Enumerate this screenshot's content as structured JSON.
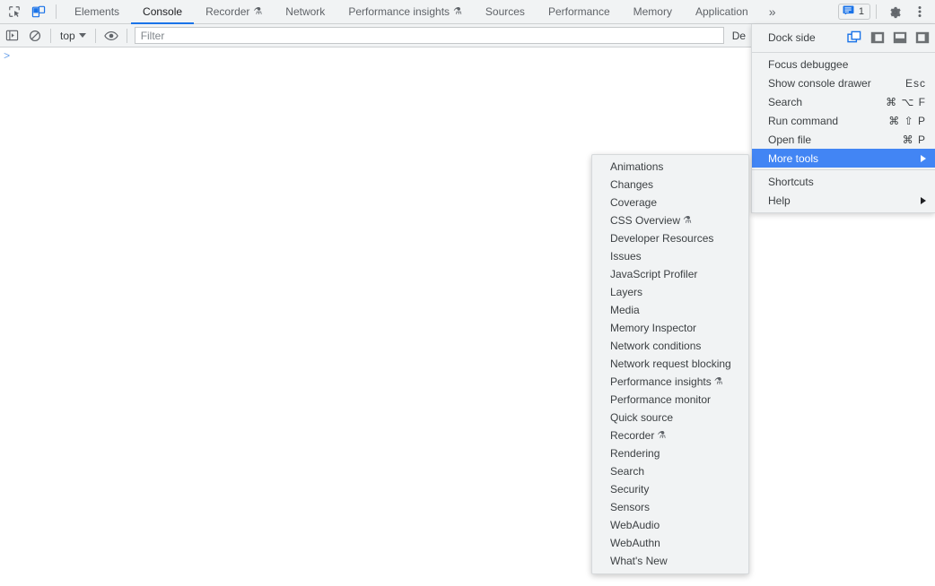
{
  "tabbar": {
    "inspect_icon": "inspect-element-icon",
    "device_icon": "device-toolbar-icon",
    "tabs": [
      {
        "label": "Elements",
        "experimental": false,
        "active": false
      },
      {
        "label": "Console",
        "experimental": false,
        "active": true
      },
      {
        "label": "Recorder",
        "experimental": true,
        "active": false
      },
      {
        "label": "Network",
        "experimental": false,
        "active": false
      },
      {
        "label": "Performance insights",
        "experimental": true,
        "active": false
      },
      {
        "label": "Sources",
        "experimental": false,
        "active": false
      },
      {
        "label": "Performance",
        "experimental": false,
        "active": false
      },
      {
        "label": "Memory",
        "experimental": false,
        "active": false
      },
      {
        "label": "Application",
        "experimental": false,
        "active": false
      }
    ],
    "overflow_label": "»",
    "issues_count": "1",
    "issues_icon": "issues-message-icon",
    "settings_icon": "gear-icon",
    "menu_icon": "three-dot-menu-icon",
    "flask_glyph": "⚗"
  },
  "console_toolbar": {
    "sidebar_icon": "console-sidebar-toggle-icon",
    "clear_icon": "clear-console-icon",
    "context": "top",
    "eye_icon": "live-expression-eye-icon",
    "filter_placeholder": "Filter",
    "levels": "De"
  },
  "console_body": {
    "prompt": ">"
  },
  "main_menu": {
    "dock_side": {
      "label": "Dock side",
      "options": [
        {
          "name": "undock-into-separate-window",
          "active": true
        },
        {
          "name": "dock-to-left",
          "active": false
        },
        {
          "name": "dock-to-bottom",
          "active": false
        },
        {
          "name": "dock-to-right",
          "active": false
        }
      ]
    },
    "items": [
      {
        "label": "Focus debuggee",
        "shortcut": "",
        "arrow": false,
        "selected": false
      },
      {
        "label": "Show console drawer",
        "shortcut": "Esc",
        "arrow": false,
        "selected": false
      },
      {
        "label": "Search",
        "shortcut": "⌘ ⌥ F",
        "arrow": false,
        "selected": false
      },
      {
        "label": "Run command",
        "shortcut": "⌘ ⇧ P",
        "arrow": false,
        "selected": false
      },
      {
        "label": "Open file",
        "shortcut": "⌘ P",
        "arrow": false,
        "selected": false
      },
      {
        "label": "More tools",
        "shortcut": "",
        "arrow": true,
        "selected": true
      },
      {
        "label": "Shortcuts",
        "shortcut": "",
        "arrow": false,
        "selected": false
      },
      {
        "label": "Help",
        "shortcut": "",
        "arrow": true,
        "selected": false
      }
    ]
  },
  "more_tools_submenu": {
    "items": [
      {
        "label": "Animations",
        "experimental": false
      },
      {
        "label": "Changes",
        "experimental": false
      },
      {
        "label": "Coverage",
        "experimental": false
      },
      {
        "label": "CSS Overview",
        "experimental": true
      },
      {
        "label": "Developer Resources",
        "experimental": false
      },
      {
        "label": "Issues",
        "experimental": false
      },
      {
        "label": "JavaScript Profiler",
        "experimental": false
      },
      {
        "label": "Layers",
        "experimental": false
      },
      {
        "label": "Media",
        "experimental": false
      },
      {
        "label": "Memory Inspector",
        "experimental": false
      },
      {
        "label": "Network conditions",
        "experimental": false
      },
      {
        "label": "Network request blocking",
        "experimental": false
      },
      {
        "label": "Performance insights",
        "experimental": true
      },
      {
        "label": "Performance monitor",
        "experimental": false
      },
      {
        "label": "Quick source",
        "experimental": false
      },
      {
        "label": "Recorder",
        "experimental": true
      },
      {
        "label": "Rendering",
        "experimental": false
      },
      {
        "label": "Search",
        "experimental": false
      },
      {
        "label": "Security",
        "experimental": false
      },
      {
        "label": "Sensors",
        "experimental": false
      },
      {
        "label": "WebAudio",
        "experimental": false
      },
      {
        "label": "WebAuthn",
        "experimental": false
      },
      {
        "label": "What's New",
        "experimental": false
      }
    ],
    "flask_glyph": "⚗"
  },
  "colors": {
    "accent_blue": "#1a73e8",
    "selection_blue": "#4285f4",
    "toolbar_bg": "#f1f3f4",
    "text": "#3c4043"
  }
}
